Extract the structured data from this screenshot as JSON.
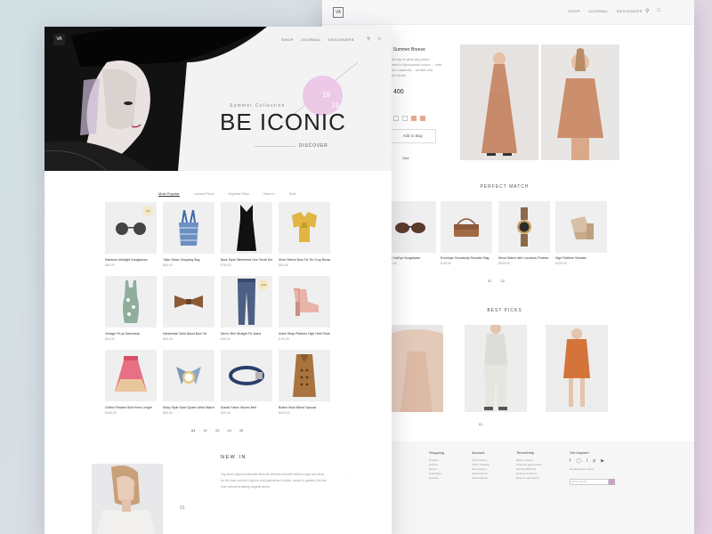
{
  "back": {
    "logo": "VA",
    "nav": [
      "SHOP",
      "JOURNAL",
      "DESIGNERS"
    ],
    "product": {
      "title": "...nt Summer Breeze",
      "description": "...matic top & wide-leg pants ...signed in light-pastel colors ... with organic materials ...dealist and modern finish.",
      "price": "400",
      "add_to_bag": "Add to Bag",
      "tab": "Size"
    },
    "perfect_match": {
      "title": "PERFECT MATCH",
      "items": [
        {
          "name": "...and CatEye Sunglasses",
          "price": "$ 100.00"
        },
        {
          "name": "Envelope Crossbody Shoulder Bag",
          "price": "$ 95.00"
        },
        {
          "name": "Wood Watch with Luxurious Finisher",
          "price": "$500.00"
        },
        {
          "name": "High Platform Sandals",
          "price": "$105.00"
        }
      ],
      "pages": [
        "01",
        "02"
      ]
    },
    "best_picks": {
      "title": "BEST PICKS",
      "page": "01"
    },
    "footer": {
      "columns": [
        {
          "heading": "Shopping",
          "links": [
            "Register",
            "Archive",
            "Saved",
            "Help/Sales",
            "Contact"
          ]
        },
        {
          "heading": "Account",
          "links": [
            "Order history",
            "Order Tracking",
            "Saved Items",
            "Subscriptions",
            "Help/Address"
          ]
        },
        {
          "heading": "Terms/Help",
          "links": [
            "Back to Home",
            "Shop our apprentices",
            "Discount/Refund",
            "Delivery & Return",
            "Returns and claims"
          ]
        }
      ],
      "newsletter": {
        "label": "Get inspired",
        "sub": "Get Exclusive Offers",
        "placeholder": "Enter email"
      }
    }
  },
  "front": {
    "logo": "VA",
    "nav": [
      "SHOP",
      "JOURNAL",
      "DESIGNERS"
    ],
    "hero": {
      "subtitle": "Summer Collection",
      "title": "BE ICONIC",
      "num_a": "18",
      "num_b": "19",
      "cta": "DISCOVER"
    },
    "filters": [
      "Most Popular",
      "Lowest Price",
      "Highest Price",
      "New In",
      "Sale"
    ],
    "products": [
      {
        "name": "Rainbow Ultralight Sunglasses",
        "price": "$60.00",
        "badge": "-5%"
      },
      {
        "name": "Tailor Stripe Shopping Bag",
        "price": "$40.00"
      },
      {
        "name": "Back Style Sleeveless One Tencil Dress",
        "price": "$ 90.00"
      },
      {
        "name": "Short Sleeve Bow Tie Tie Crop Blouse Top",
        "price": "$50.00"
      },
      {
        "name": "Vintage Fit-up Swimwear",
        "price": "$24.00"
      },
      {
        "name": "Handmade Solid Wood Bow Tie",
        "price": "$30.00"
      },
      {
        "name": "Men's Slim Straight Fit Jeans",
        "price": "$30.00",
        "badge": "-20%"
      },
      {
        "name": "Ankle Strap Platform High Heel Shoes",
        "price": "$ 90.00"
      },
      {
        "name": "Chiffon Pleated Skirt Knee Length",
        "price": "$150.00"
      },
      {
        "name": "Noisy Style Scarf Quartz Wrist Watch",
        "price": "$69.00"
      },
      {
        "name": "Elastic Fabric Woven Belt",
        "price": "$30.00"
      },
      {
        "name": "Button Wool Blend Topcoat",
        "price": "$415.00"
      }
    ],
    "pages": [
      "01",
      "02",
      "03",
      "04",
      "05"
    ],
    "bottom": {
      "title": "NEW IN",
      "description": "Top-level organic materials Best bio-friendly summer fabrics Light and flexy for the best comfort Light-to-bold garments in white, cream & pastels Get the look without breaking original dress",
      "arrow": "01"
    }
  }
}
